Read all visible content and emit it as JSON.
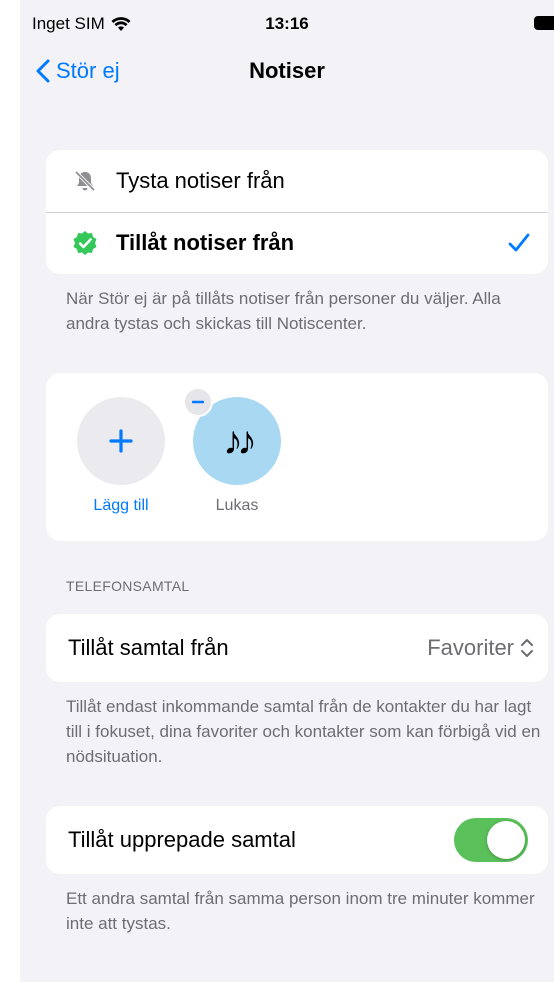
{
  "status_bar": {
    "carrier": "Inget SIM",
    "time": "13:16"
  },
  "nav": {
    "back_label": "Stör ej",
    "title": "Notiser"
  },
  "mode": {
    "silence_label": "Tysta notiser från",
    "allow_label": "Tillåt notiser från",
    "selected": "allow",
    "footer": "När Stör ej är på tillåts notiser från personer du väljer. Alla andra tystas och skickas till Notiscenter."
  },
  "people": {
    "add_label": "Lägg till",
    "contacts": [
      {
        "name": "Lukas",
        "avatar": "♪♪"
      }
    ]
  },
  "calls": {
    "section_header": "TELEFONSAMTAL",
    "allow_calls_label": "Tillåt samtal från",
    "allow_calls_value": "Favoriter",
    "footer": "Tillåt endast inkommande samtal från de kontakter du har lagt till i fokuset, dina favoriter och kontakter som kan förbigå vid en nödsituation.",
    "repeated_label": "Tillåt upprepade samtal",
    "repeated_on": true,
    "repeated_footer": "Ett andra samtal från samma person inom tre minuter kommer inte att tystas."
  },
  "colors": {
    "accent": "#007aff",
    "toggle_on": "#5ac05a",
    "badge_green": "#34c759",
    "avatar_bg": "#a9d8f3"
  }
}
